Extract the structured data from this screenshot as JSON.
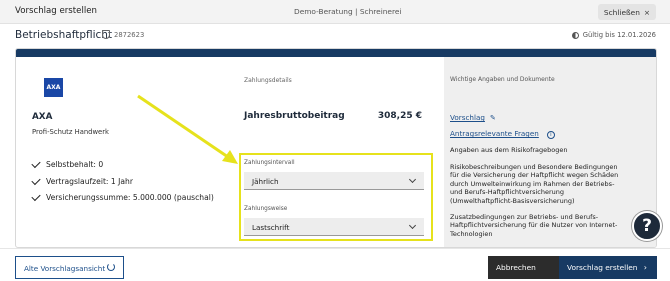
{
  "topbar": {
    "title": "Vorschlag erstellen",
    "center": "Demo-Beratung | Schreinerei",
    "close_label": "Schließen",
    "close_icon": "×"
  },
  "subheader": {
    "title": "Betriebshaftpflicht",
    "id": "2872623",
    "validity": "Gültig bis 12.01.2026"
  },
  "offer": {
    "logo_text": "AXA",
    "company": "AXA",
    "product": "Profi-Schutz Handwerk",
    "features": [
      "Selbstbehalt: 0",
      "Vertragslaufzeit: 1 Jahr",
      "Versicherungssumme: 5.000.000 (pauschal)"
    ]
  },
  "payment": {
    "section_label": "Zahlungsdetails",
    "premium_label": "Jahresbruttobeitrag",
    "premium_value": "308,25 €",
    "interval_label": "Zahlungsintervall",
    "interval_value": "Jährlich",
    "method_label": "Zahlungsweise",
    "method_value": "Lastschrift"
  },
  "documents": {
    "heading": "Wichtige Angaben und Dokumente",
    "vorschlag_link": "Vorschlag",
    "antrag_link": "Antragsrelevante Fragen",
    "items": [
      "Angaben aus dem Risikofragebogen",
      "Risikobeschreibungen und Besondere Bedingungen für die Versicherung der Haftpflicht wegen Schäden durch Umwelteinwirkung im Rahmen der Betriebs- und Berufs-Haftpflichtversicherung (Umwelthaftpflicht-Basisversicherung)",
      "Zusatzbedingungen zur Betriebs- und Berufs-Haftpflichtversicherung für die Nutzer von Internet-Technologien"
    ]
  },
  "help": {
    "label": "?"
  },
  "footer": {
    "old_view_label": "Alte Vorschlagsansicht",
    "cancel_label": "Abbrechen",
    "create_label": "Vorschlag erstellen",
    "create_arrow": "›"
  },
  "colors": {
    "brand_dark": "#173a63",
    "highlight": "#e6e21c",
    "link": "#1d4f8a"
  }
}
